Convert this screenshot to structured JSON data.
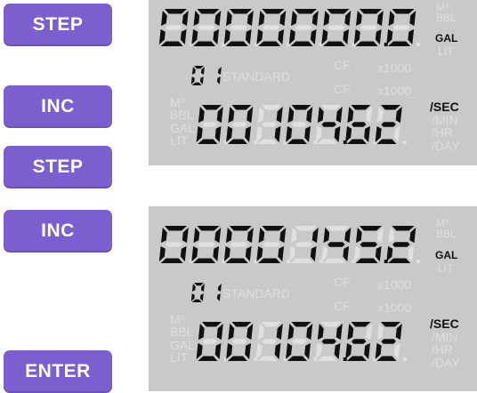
{
  "buttons": {
    "step_1": "STEP",
    "inc_1": "INC",
    "step_2": "STEP",
    "inc_2": "INC",
    "enter": "ENTER"
  },
  "colors": {
    "button": "#7b5fcf",
    "lcd_background": "#c9c9c9",
    "segment_on": "#111111",
    "segment_off": "#e0e0e0"
  },
  "display_1": {
    "total_digits": "00000000",
    "total_unit": "GAL",
    "channel": "01",
    "rate_digits": "0010462",
    "rate_unit": "/SEC",
    "ghost_standard": "STANDARD",
    "ghost_cf": [
      "CF",
      "CF"
    ],
    "ghost_x1000": [
      "x1000",
      "x1000"
    ],
    "ghost_total_units": [
      "M³",
      "BBL",
      "LIT"
    ],
    "ghost_rate_units_left": [
      "M³",
      "BBL",
      "GAL",
      "LIT"
    ],
    "ghost_rate_units_right": [
      "/MIN",
      "/HR",
      "/DAY"
    ]
  },
  "display_2": {
    "total_digits": "00001452",
    "total_unit": "GAL",
    "channel": "01",
    "rate_digits": "0010462",
    "rate_unit": "/SEC",
    "ghost_standard": "STANDARD",
    "ghost_cf": [
      "CF",
      "CF"
    ],
    "ghost_x1000": [
      "x1000",
      "x1000"
    ],
    "ghost_total_units": [
      "M³",
      "BBL",
      "LIT"
    ],
    "ghost_rate_units_left": [
      "M³",
      "BBL",
      "GAL",
      "LIT"
    ],
    "ghost_rate_units_right": [
      "/MIN",
      "/HR",
      "/DAY"
    ]
  }
}
